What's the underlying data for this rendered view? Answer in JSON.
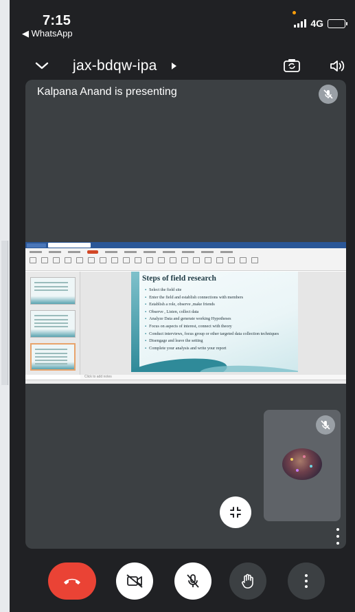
{
  "status_bar": {
    "time": "7:15",
    "back_app": "◀ WhatsApp",
    "network": "4G",
    "colors": {
      "battery": "#ffd60a",
      "privacy_dot": "#ff9f0a"
    }
  },
  "header": {
    "meeting_code": "jax-bdqw-ipa",
    "icons": [
      "chevron-down-icon",
      "switch-camera-icon",
      "speaker-icon"
    ]
  },
  "presentation": {
    "presenting_label": "Kalpana Anand is presenting",
    "slide_title": "Steps of field research",
    "slide_bullets": [
      "Select the field site",
      "Enter the field and establish connections with members",
      "Establish a role, observe ,make friends",
      "Observe , Listen, collect data",
      "Analyze Data and generate working Hypotheses",
      "Focus on aspects of interest, connect with theory",
      "Conduct interviews, focus group or other targeted data collection techniques",
      "Disengage and leave the setting",
      "Complete your analysis and write your report"
    ],
    "notes_placeholder": "Click to add notes"
  },
  "controls": {
    "icons": [
      "end-call-icon",
      "camera-off-icon",
      "mic-off-icon",
      "raise-hand-icon",
      "more-options-icon"
    ],
    "colors": {
      "end_call": "#ea4335",
      "background": "#202124",
      "tile": "#3c4043"
    }
  }
}
